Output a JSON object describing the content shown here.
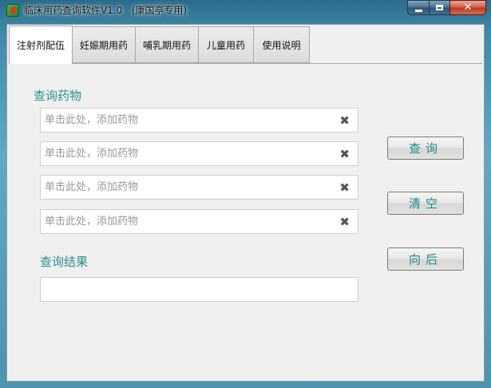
{
  "window": {
    "title": "临床用药查询软件V1.0   (康国亭专用)",
    "minimize_glyph": "",
    "maximize_glyph": "",
    "close_glyph": "✕"
  },
  "tabs": [
    {
      "label": "注射剂配伍",
      "active": true
    },
    {
      "label": "妊娠期用药",
      "active": false
    },
    {
      "label": "哺乳期用药",
      "active": false
    },
    {
      "label": "儿童用药",
      "active": false
    },
    {
      "label": "使用说明",
      "active": false
    }
  ],
  "query": {
    "section_label": "查询药物",
    "inputs": [
      {
        "value": "",
        "placeholder": "单击此处，添加药物",
        "clear_glyph": "✖"
      },
      {
        "value": "",
        "placeholder": "单击此处，添加药物",
        "clear_glyph": "✖"
      },
      {
        "value": "",
        "placeholder": "单击此处，添加药物",
        "clear_glyph": "✖"
      },
      {
        "value": "",
        "placeholder": "单击此处，添加药物",
        "clear_glyph": "✖"
      }
    ]
  },
  "result": {
    "section_label": "查询结果",
    "value": ""
  },
  "buttons": {
    "query_label": "查询",
    "clear_label": "清空",
    "back_label": "向后"
  },
  "colors": {
    "accent_text": "#2a8f8f",
    "button_text": "#1f8a8a"
  },
  "icons": {
    "app": "app-icon",
    "clear": "clear-x-icon"
  }
}
